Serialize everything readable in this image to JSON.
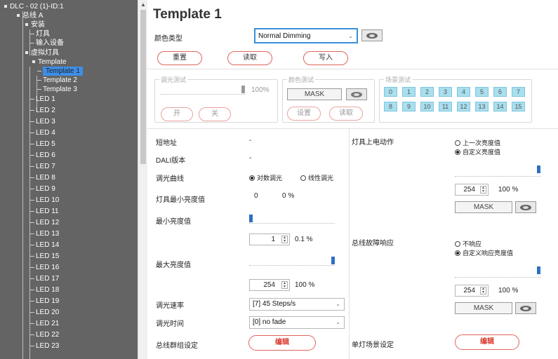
{
  "tree": {
    "root": "DLC - 02 (1)-ID:1",
    "bus": "总线 A",
    "install": "安装",
    "fixtures": "灯具",
    "input_devices": "输入设备",
    "virtual_fixtures": "虚拟灯具",
    "template_group": "Template",
    "templates": [
      "Template 1",
      "Template 2",
      "Template 3"
    ],
    "leds": [
      "LED 1",
      "LED 2",
      "LED 3",
      "LED 4",
      "LED 5",
      "LED 6",
      "LED 7",
      "LED 8",
      "LED 9",
      "LED 10",
      "LED 11",
      "LED 12",
      "LED 13",
      "LED 14",
      "LED 15",
      "LED 16",
      "LED 17",
      "LED 18",
      "LED 19",
      "LED 20",
      "LED 21",
      "LED 22",
      "LED 23"
    ]
  },
  "header": {
    "title": "Template 1",
    "color_type_label": "颜色类型",
    "color_type_value": "Normal Dimming",
    "reset": "重置",
    "read": "读取",
    "write": "写入"
  },
  "dimming_test": {
    "title": "调光测试",
    "percent": "100%",
    "level": 1.0,
    "on": "开",
    "off": "关"
  },
  "color_test": {
    "title": "颜色测试",
    "mask": "MASK",
    "set": "设置",
    "read": "读取"
  },
  "scene_test": {
    "title": "场景测试",
    "scenes": [
      "0",
      "1",
      "2",
      "3",
      "4",
      "5",
      "6",
      "7",
      "8",
      "9",
      "10",
      "11",
      "12",
      "13",
      "14",
      "15"
    ]
  },
  "props": {
    "short_addr_label": "短地址",
    "short_addr_value": "-",
    "dali_label": "DALI版本",
    "dali_value": "-",
    "curve_label": "调光曲线",
    "curve_log": "对数调光",
    "curve_linear": "线性调光",
    "phys_min_label": "灯具最小亮度值",
    "phys_min_value": "0",
    "phys_min_pct": "0 %",
    "min_label": "最小亮度值",
    "min_level": 0.0,
    "min_value": "1",
    "min_pct": "0.1 %",
    "max_label": "最大亮度值",
    "max_level": 1.0,
    "max_value": "254",
    "max_pct": "100 %",
    "fade_rate_label": "调光速率",
    "fade_rate_value": "[7] 45 Steps/s",
    "fade_time_label": "调光时间",
    "fade_time_value": "[0] no fade",
    "group_label": "总线群组设定",
    "edit": "编辑"
  },
  "power_on": {
    "label": "灯具上电动作",
    "opt_last": "上一次亮度值",
    "opt_custom": "自定义亮度值",
    "level": 1.0,
    "value": "254",
    "pct": "100 %",
    "mask": "MASK"
  },
  "failure": {
    "label": "总线故障响应",
    "opt_none": "不响应",
    "opt_custom": "自定义响应亮度值",
    "level": 1.0,
    "value": "254",
    "pct": "100 %",
    "mask": "MASK"
  },
  "scene_setup": {
    "label": "单灯场景设定",
    "edit": "编辑"
  },
  "colors": {
    "tree_bg": "#646464",
    "selected": "#3e8ee6",
    "accent_red": "#e0645a",
    "slider_blue": "#2e6fc4",
    "scene_cyan": "#a9dfee"
  },
  "icons": [
    "eye-icon",
    "caret-down-icon",
    "spin-icon",
    "bullet-icon"
  ]
}
